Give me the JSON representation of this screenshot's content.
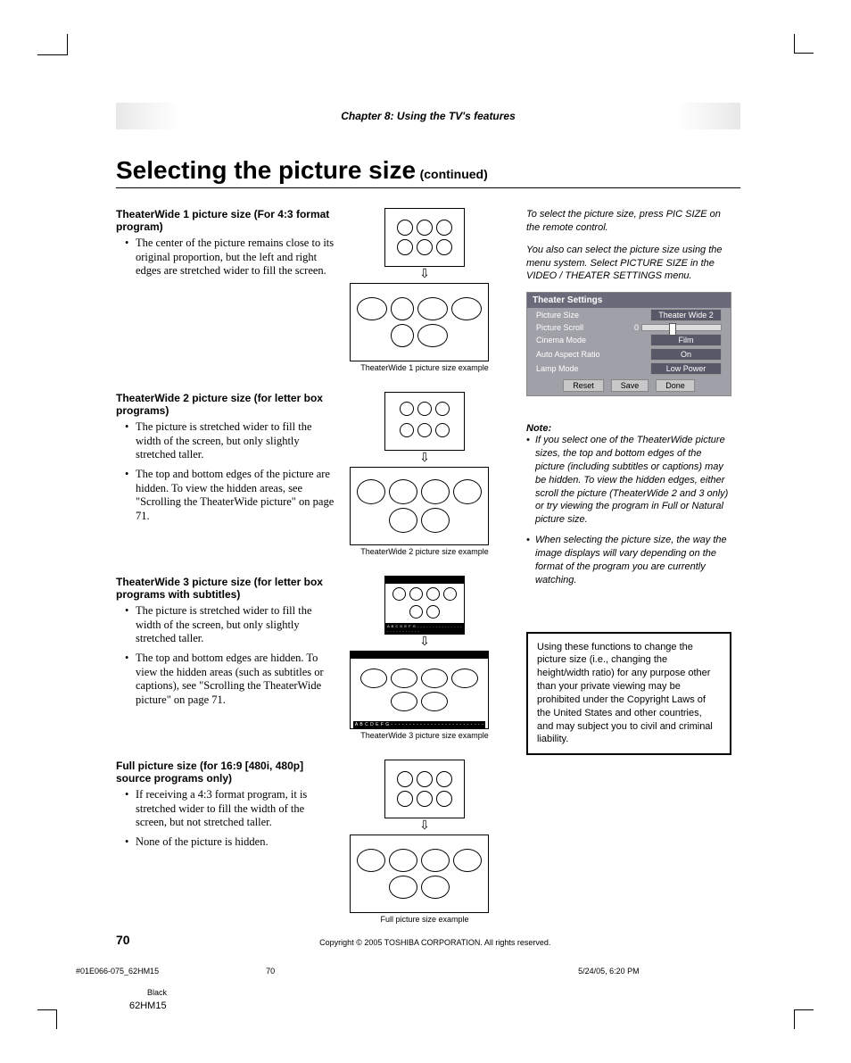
{
  "chapter": "Chapter 8: Using the TV's features",
  "title_main": "Selecting the picture size",
  "title_sub": "(continued)",
  "sections": [
    {
      "heading": "TheaterWide 1 picture size (For 4:3 format program)",
      "bullets": [
        "The center of the picture remains close to its original proportion, but the left and right edges are stretched wider to fill the screen."
      ],
      "caption": "TheaterWide 1 picture size example"
    },
    {
      "heading": "TheaterWide 2 picture size (for letter box programs)",
      "bullets": [
        "The picture is stretched wider to fill the width of the screen, but only slightly stretched taller.",
        "The top and bottom edges of the picture are hidden. To view the hidden areas, see \"Scrolling the TheaterWide picture\" on page 71."
      ],
      "caption": "TheaterWide 2 picture size example"
    },
    {
      "heading": "TheaterWide 3 picture size (for letter box programs with subtitles)",
      "bullets": [
        "The picture is stretched wider to fill the width of the screen, but only slightly stretched taller.",
        "The top and bottom edges are hidden. To view the hidden areas (such as subtitles or captions), see \"Scrolling the TheaterWide picture\" on page 71."
      ],
      "caption": "TheaterWide 3 picture size example",
      "subtitle_text": "A B C D E F G - - - - - - - - - - - - - - - - - - - - - - - - - -"
    },
    {
      "heading": "Full picture size (for 16:9 [480i, 480p] source programs only)",
      "bullets": [
        "If receiving a 4:3 format program, it is stretched wider to fill the width of the screen, but not stretched taller.",
        "None of the picture is hidden."
      ],
      "caption": "Full picture size example"
    }
  ],
  "right": {
    "intro1": "To select the picture size, press PIC SIZE on the remote control.",
    "intro2": "You also can select the picture size using the menu system. Select PICTURE SIZE in the VIDEO / THEATER SETTINGS menu.",
    "menu": {
      "title": "Theater Settings",
      "rows": [
        {
          "label": "Picture Size",
          "value": "Theater Wide 2"
        },
        {
          "label": "Picture Scroll",
          "value_slider_left": "0"
        },
        {
          "label": "Cinema Mode",
          "value": "Film"
        },
        {
          "label": "Auto Aspect Ratio",
          "value": "On"
        },
        {
          "label": "Lamp Mode",
          "value": "Low Power"
        }
      ],
      "buttons": [
        "Reset",
        "Save",
        "Done"
      ]
    },
    "note_heading": "Note:",
    "notes": [
      "If you select one of the TheaterWide picture sizes, the top and bottom edges of the picture (including subtitles or captions) may be hidden. To view the hidden edges, either scroll the picture (TheaterWide 2 and 3 only) or try viewing the program in Full or Natural picture size.",
      "When selecting the picture size, the way the image displays will vary depending on the format of the program you are currently watching."
    ],
    "warning": "Using these functions to change the picture size (i.e., changing the height/width ratio) for any purpose other than your private viewing may be prohibited under the Copyright Laws of the United States and other countries, and may subject you to civil and criminal liability."
  },
  "footer": {
    "page": "70",
    "copyright": "Copyright © 2005 TOSHIBA CORPORATION. All rights reserved.",
    "file": "#01E066-075_62HM15",
    "pg2": "70",
    "timestamp": "5/24/05, 6:20 PM",
    "color": "Black",
    "model": "62HM15"
  }
}
